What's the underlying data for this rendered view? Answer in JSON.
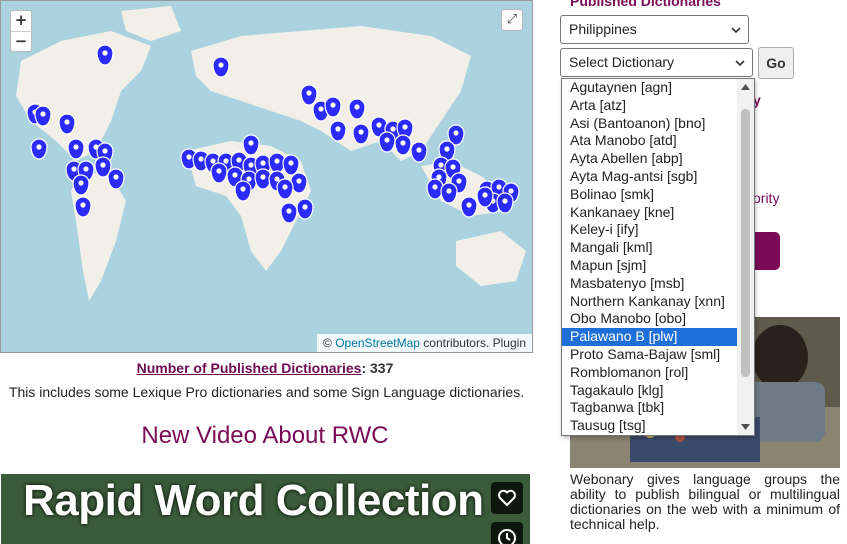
{
  "map": {
    "zoom_in": "+",
    "zoom_out": "−",
    "fullscreen": "⤢",
    "attribution_symbol": "©",
    "attribution_link": "OpenStreetMap",
    "attribution_rest": "contributors. Plugin"
  },
  "stats": {
    "count_label": "Number of Published Dictionaries",
    "count_sep": ":",
    "count_value": "337",
    "includes_text": "This includes some Lexique Pro dictionaries and some Sign Language dictionaries."
  },
  "video": {
    "heading": "New Video About RWC",
    "title": "Rapid Word Collection"
  },
  "sidebar": {
    "heading": "Published Dictionaries",
    "country_value": "Philippines",
    "dictionary_value": "Select Dictionary",
    "go_label": "Go",
    "fragment_y": "y",
    "fragment_authority": "ority",
    "webonary_text": "Webonary gives language groups the ability to publish bilingual or multilingual dictionaries on the web with a minimum of technical help."
  },
  "dictionaries": [
    "Agutaynen [agn]",
    "Arta [atz]",
    "Asi (Bantoanon) [bno]",
    "Ata Manobo [atd]",
    "Ayta Abellen [abp]",
    "Ayta Mag-antsi [sgb]",
    "Bolinao [smk]",
    "Kankanaey [kne]",
    "Keley-i [ify]",
    "Mangali [kml]",
    "Mapun [sjm]",
    "Masbatenyo [msb]",
    "Northern Kankanay [xnn]",
    "Obo Manobo [obo]",
    "Palawano B [plw]",
    "Proto Sama-Bajaw [sml]",
    "Romblomanon [rol]",
    "Tagakaulo [klg]",
    "Tagbanwa [tbk]",
    "Tausug [tsg]"
  ],
  "selected_index": 14,
  "colors": {
    "brand": "#7a0b57",
    "marker": "#2b2bff",
    "highlight": "#1e6fd9",
    "water": "#aad3df",
    "land": "#f2efe9"
  },
  "icons": {
    "marker": "map-marker-icon",
    "heart": "heart-icon",
    "clock": "clock-icon",
    "chevron": "chevron-down-icon"
  }
}
